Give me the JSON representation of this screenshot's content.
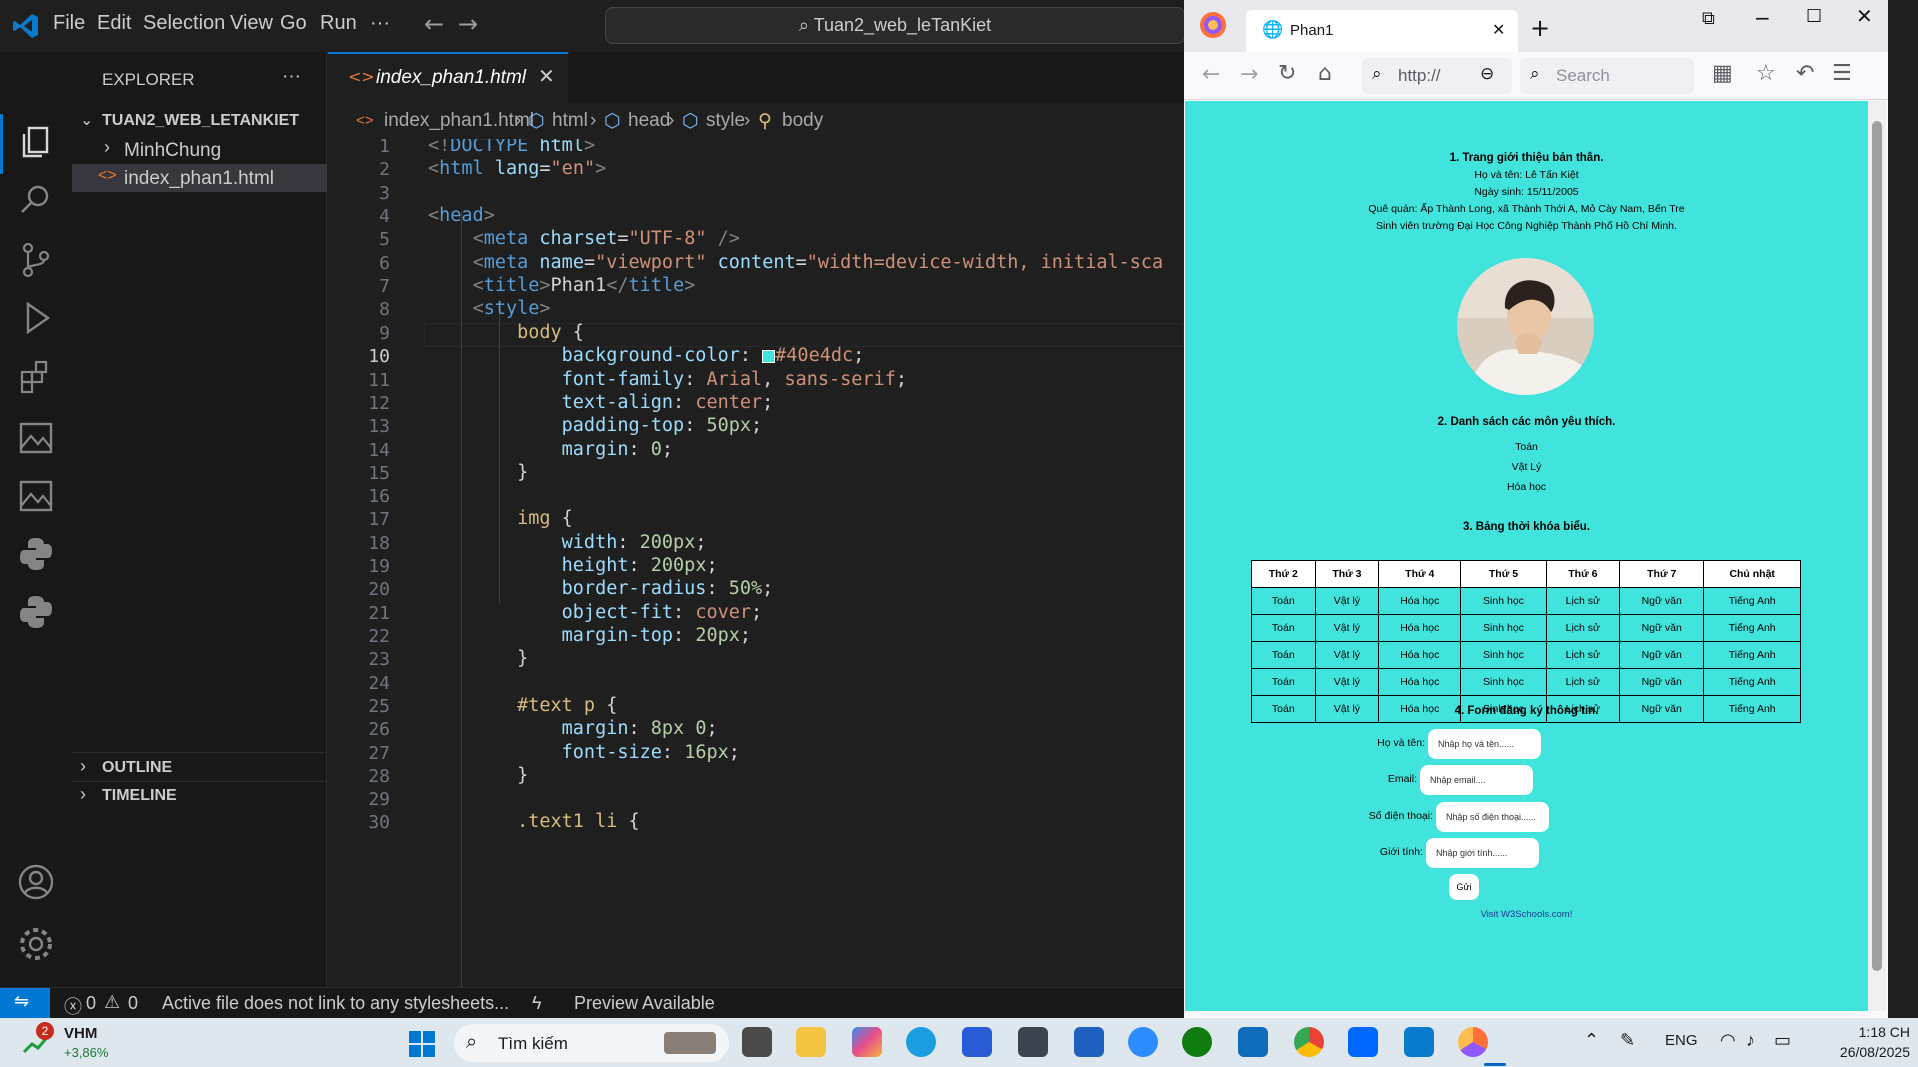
{
  "vscode": {
    "menu": [
      "File",
      "Edit",
      "Selection",
      "View",
      "Go",
      "Run",
      "···"
    ],
    "command_center": "Tuan2_web_leTanKiet",
    "explorer_title": "EXPLORER",
    "explorer_more": "···",
    "workspace_name": "TUAN2_WEB_LETANKIET",
    "tree": [
      {
        "label": "MinhChung",
        "kind": "folder"
      },
      {
        "label": "index_phan1.html",
        "kind": "file"
      }
    ],
    "outline_label": "OUTLINE",
    "timeline_label": "TIMELINE",
    "tab_label": "index_phan1.html",
    "breadcrumb": [
      "index_phan1.html",
      "html",
      "head",
      "style",
      "body"
    ],
    "line_numbers": [
      "1",
      "2",
      "3",
      "4",
      "5",
      "6",
      "7",
      "8",
      "9",
      "10",
      "11",
      "12",
      "13",
      "14",
      "15",
      "16",
      "17",
      "18",
      "19",
      "20",
      "21",
      "22",
      "23",
      "24",
      "25",
      "26",
      "27",
      "28",
      "29",
      "30"
    ],
    "active_line": "10",
    "swatch_color": "#40e4dc",
    "status": {
      "errors": "0",
      "warnings": "0",
      "message": "Active file does not link to any stylesheets...",
      "preview": "Preview Available"
    }
  },
  "browser": {
    "tab_title": "Phan1",
    "url_text": "http://",
    "search_placeholder": "Search",
    "page_bg": "#40e4dc",
    "section1": {
      "heading": "1. Trang giới thiệu bản thân.",
      "lines": [
        "Họ và tên: Lê Tấn Kiệt",
        "Ngày sinh: 15/11/2005",
        "Quê quán: Ấp Thành Long, xã Thành Thới A, Mỏ Cày Nam, Bến Tre",
        "Sinh viên trường Đại Học Công Nghiệp Thành Phố Hồ Chí Minh."
      ]
    },
    "section2": {
      "heading": "2. Danh sách các môn yêu thích.",
      "items": [
        "Toán",
        "Vật Lý",
        "Hóa học"
      ]
    },
    "section3": {
      "heading": "3. Bảng thời khóa biểu.",
      "headers": [
        "Thứ 2",
        "Thứ 3",
        "Thứ 4",
        "Thứ 5",
        "Thứ 6",
        "Thứ 7",
        "Chủ nhật"
      ],
      "rows": [
        [
          "Toán",
          "Vật lý",
          "Hóa học",
          "Sinh học",
          "Lịch sử",
          "Ngữ văn",
          "Tiếng Anh"
        ],
        [
          "Toán",
          "Vật lý",
          "Hóa học",
          "Sinh học",
          "Lịch sử",
          "Ngữ văn",
          "Tiếng Anh"
        ],
        [
          "Toán",
          "Vật lý",
          "Hóa học",
          "Sinh học",
          "Lịch sử",
          "Ngữ văn",
          "Tiếng Anh"
        ],
        [
          "Toán",
          "Vật lý",
          "Hóa học",
          "Sinh học",
          "Lịch sử",
          "Ngữ văn",
          "Tiếng Anh"
        ],
        [
          "Toán",
          "Vật lý",
          "Hóa học",
          "Sinh học",
          "Lịch sử",
          "Ngữ văn",
          "Tiếng Anh"
        ]
      ]
    },
    "section4": {
      "heading": "4. Form đăng ký thông tin.",
      "fields": [
        {
          "label": "Họ và tên:",
          "placeholder": "Nhập họ và tên......"
        },
        {
          "label": "Email:",
          "placeholder": "Nhập email...."
        },
        {
          "label": "Số điện thoại:",
          "placeholder": "Nhập số điện thoại......"
        },
        {
          "label": "Giới tính:",
          "placeholder": "Nhập giới tính......"
        }
      ],
      "submit": "Gửi"
    },
    "footer_link": "Visit W3Schools.com!"
  },
  "taskbar": {
    "stock_name": "VHM",
    "stock_change": "+3,86%",
    "notification_count": "2",
    "search_label": "Tìm kiếm",
    "language": "ENG",
    "time": "1:18 CH",
    "date": "26/08/2025"
  }
}
